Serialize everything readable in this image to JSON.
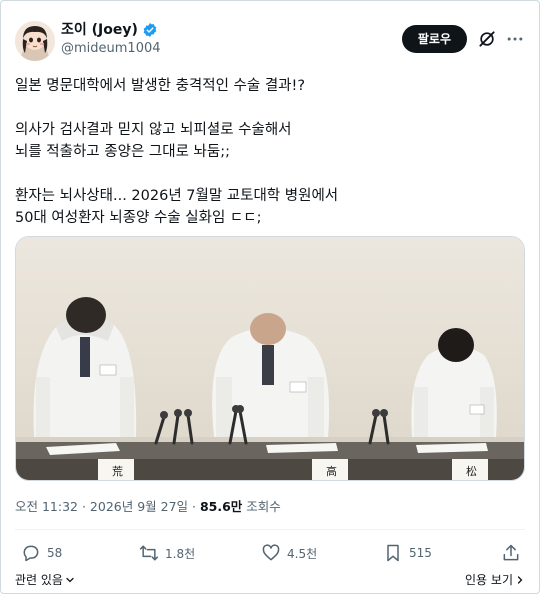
{
  "user": {
    "display_name": "조이 (Joey)",
    "handle": "@mideum1004"
  },
  "header": {
    "follow_label": "팔로우"
  },
  "tweet": {
    "lines": [
      "일본 명문대학에서 발생한 충격적인 수술 결과!?",
      "의사가 검사결과 믿지 않고 뇌피셜로 수술해서",
      "뇌를 적출하고 종양은 그대로 놔둠;;",
      "환자는 뇌사상태... 2026년 7월말 교토대학 병원에서",
      "50대 여성환자 뇌종양 수술 실화임 ㄷㄷ;"
    ]
  },
  "photo": {
    "nameplates": [
      "荒",
      "高",
      "松"
    ]
  },
  "meta": {
    "timestamp": "오전 11:32 · 2026년 9월 27일",
    "separator": " · ",
    "views_count": "85.6만",
    "views_label": "조회수"
  },
  "actions": {
    "replies": "58",
    "reposts": "1.8천",
    "likes": "4.5천",
    "bookmarks": "515"
  },
  "footer": {
    "related_label": "관련 있음",
    "quotes_label": "인용 보기"
  },
  "colors": {
    "verified": "#1d9bf0",
    "muted": "#536471",
    "text": "#0f1419"
  }
}
